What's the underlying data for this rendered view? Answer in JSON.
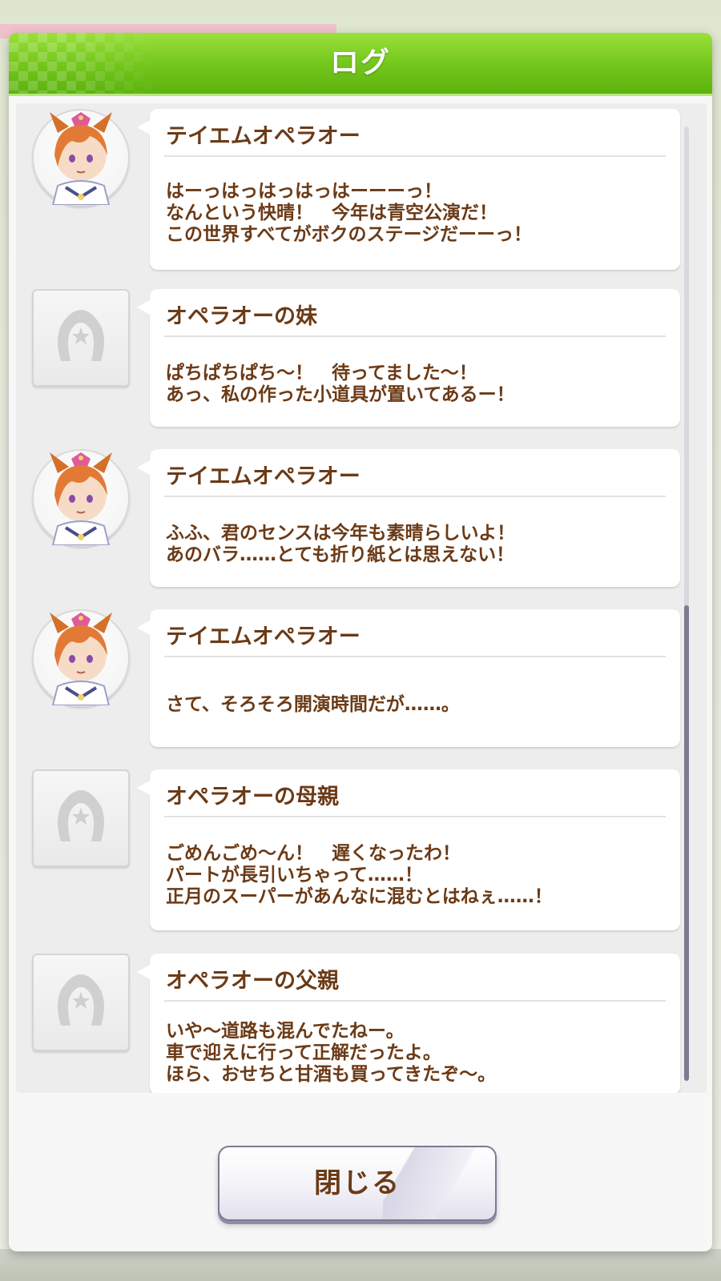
{
  "header": {
    "title": "ログ"
  },
  "log": {
    "entries": [
      {
        "speaker": "テイエムオペラオー",
        "avatar": "character-portrait",
        "lines": [
          "はーっはっはっはっはーーーっ！",
          "なんという快晴！　今年は青空公演だ！",
          "この世界すべてがボクのステージだーーっ！"
        ]
      },
      {
        "speaker": "オペラオーの妹",
        "avatar": "placeholder-horseshoe",
        "lines": [
          "ぱちぱちぱち～！　待ってました～！",
          "あっ、私の作った小道具が置いてあるー！"
        ]
      },
      {
        "speaker": "テイエムオペラオー",
        "avatar": "character-portrait",
        "lines": [
          "ふふ、君のセンスは今年も素晴らしいよ！",
          "あのバラ……とても折り紙とは思えない！"
        ]
      },
      {
        "speaker": "テイエムオペラオー",
        "avatar": "character-portrait",
        "lines": [
          "さて、そろそろ開演時間だが……。"
        ]
      },
      {
        "speaker": "オペラオーの母親",
        "avatar": "placeholder-horseshoe",
        "lines": [
          "ごめんごめ～ん！　遅くなったわ！",
          "パートが長引いちゃって……！",
          "正月のスーパーがあんなに混むとはねぇ……！"
        ]
      },
      {
        "speaker": "オペラオーの父親",
        "avatar": "placeholder-horseshoe",
        "lines": [
          "いや～道路も混んでたねー。",
          "車で迎えに行って正解だったよ。",
          "ほら、おせちと甘酒も買ってきたぞ～。"
        ]
      }
    ]
  },
  "footer": {
    "close_label": "閉じる"
  },
  "colors": {
    "header_green": "#72c51a",
    "text_brown": "#6b3a16",
    "scroll_thumb": "#7d7b8e"
  }
}
